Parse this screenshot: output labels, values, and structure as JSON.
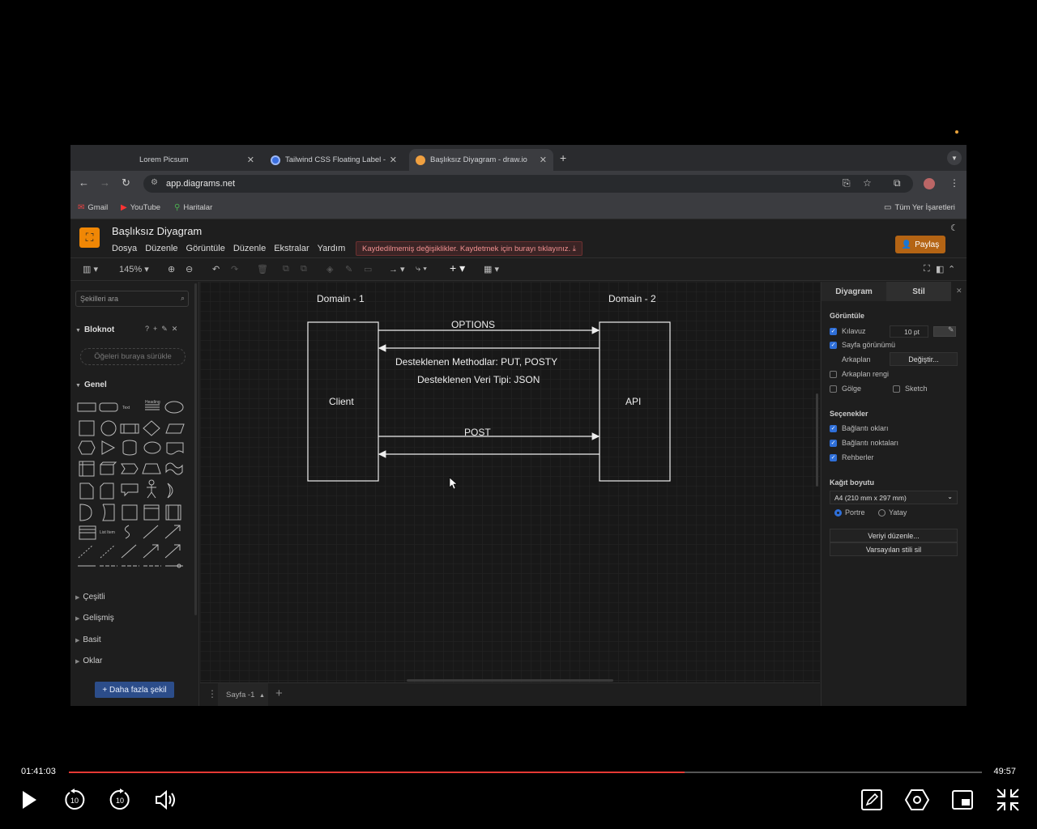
{
  "browser": {
    "tabs": [
      {
        "label": "Lorem Picsum",
        "active": false
      },
      {
        "label": "Tailwind CSS Floating Label -",
        "active": false
      },
      {
        "label": "Başlıksız Diyagram - draw.io",
        "active": true
      }
    ],
    "url": "app.diagrams.net",
    "bookmarks": [
      {
        "label": "Gmail",
        "icon": "gmail-icon"
      },
      {
        "label": "YouTube",
        "icon": "youtube-icon"
      },
      {
        "label": "Haritalar",
        "icon": "maps-icon"
      }
    ],
    "all_bookmarks": "Tüm Yer İşaretleri"
  },
  "app": {
    "title": "Başlıksız Diyagram",
    "menus": [
      "Dosya",
      "Düzenle",
      "Görüntüle",
      "Düzenle",
      "Ekstralar",
      "Yardım"
    ],
    "unsaved_notice": "Kaydedilmemiş değişiklikler. Kaydetmek için burayı tıklayınız.",
    "share_label": "Paylaş",
    "zoom": "145%"
  },
  "left_panel": {
    "search_placeholder": "Şekilleri ara",
    "scratchpad_title": "Bloknot",
    "dropzone": "Öğeleri buraya sürükle",
    "general_title": "Genel",
    "categories": [
      "Çeşitli",
      "Gelişmiş",
      "Basit",
      "Oklar"
    ],
    "more_shapes": "+ Daha fazla şekil"
  },
  "diagram": {
    "domain1": "Domain - 1",
    "domain2": "Domain - 2",
    "client": "Client",
    "api": "API",
    "options": "OPTIONS",
    "methods": "Desteklenen Methodlar: PUT, POSTY",
    "data_type": "Desteklenen Veri Tipi: JSON",
    "post": "POST"
  },
  "page_tab": "Sayfa -1",
  "right_panel": {
    "tab_diagram": "Diyagram",
    "tab_style": "Stil",
    "view_heading": "Görüntüle",
    "grid": "Kılavuz",
    "grid_size": "10 pt",
    "page_view": "Sayfa görünümü",
    "background": "Arkaplan",
    "change": "Değiştir...",
    "bg_color": "Arkaplan rengi",
    "shadow": "Gölge",
    "sketch": "Sketch",
    "options_heading": "Seçenekler",
    "conn_arrows": "Bağlantı okları",
    "conn_points": "Bağlantı noktaları",
    "guides": "Rehberler",
    "paper_heading": "Kağıt boyutu",
    "paper_size": "A4 (210 mm x 297 mm)",
    "portrait": "Portre",
    "landscape": "Yatay",
    "edit_data": "Veriyi düzenle...",
    "clear_style": "Varsayılan stili sil"
  },
  "video": {
    "elapsed": "01:41:03",
    "remaining": "49:57",
    "progress": 0.674,
    "accent": "#e53935"
  }
}
